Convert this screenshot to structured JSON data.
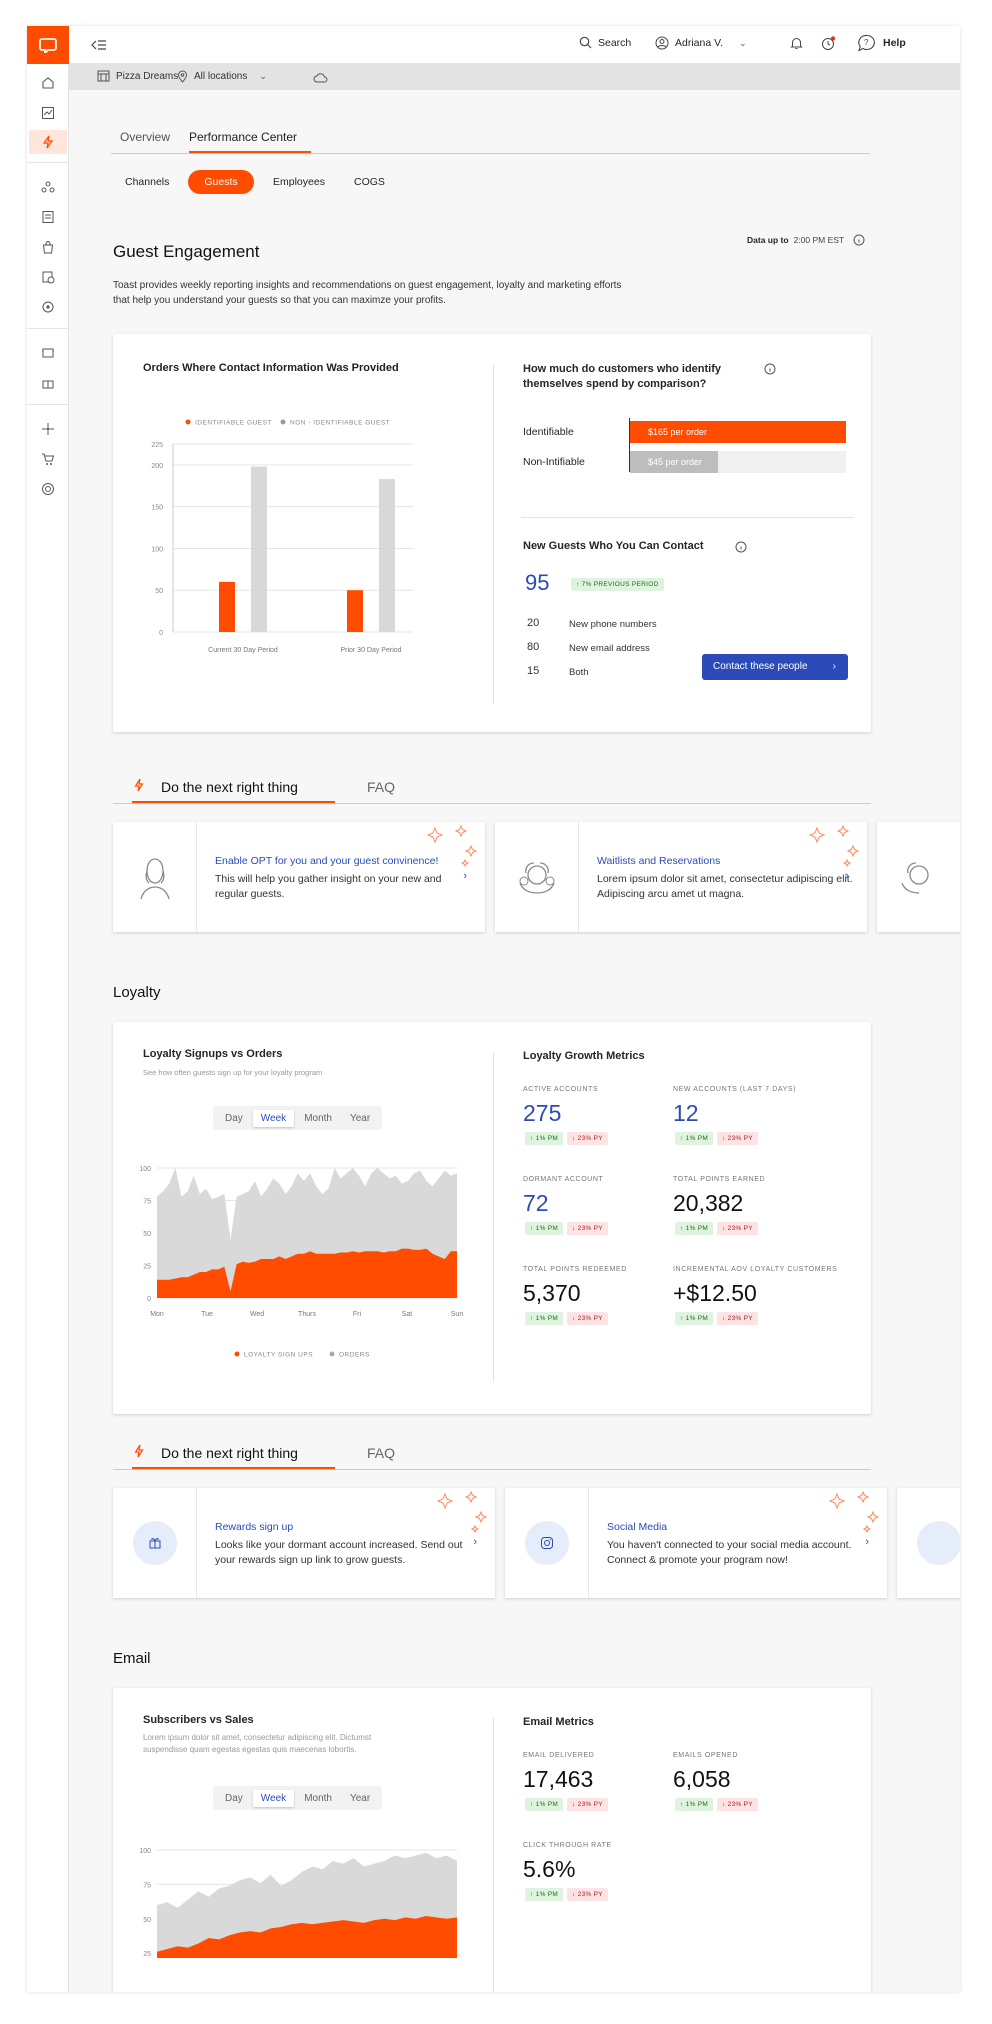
{
  "topbar": {
    "search_label": "Search",
    "user_name": "Adriana V.",
    "help_label": "Help"
  },
  "subbar": {
    "restaurant": "Pizza Dreams",
    "locations": "All locations"
  },
  "tabs": {
    "overview": "Overview",
    "performance": "Performance Center"
  },
  "subtabs": {
    "channels": "Channels",
    "guests": "Guests",
    "employees": "Employees",
    "cogs": "COGS"
  },
  "guest": {
    "title": "Guest Engagement",
    "data_up_to_label": "Data up to",
    "data_up_to_time": "2:00 PM EST",
    "description_1": "Toast provides weekly reporting insights and recommendations on guest engagement, loyalty and marketing efforts",
    "description_2": "that help you understand your guests so that you can maximze your profits.",
    "orders_title": "Orders Where Contact Information Was Provided",
    "spend_title_1": "How much do customers who identify",
    "spend_title_2": "themselves spend by comparison?",
    "spend_rows": [
      {
        "label": "Identifiable",
        "value": "$165 per order"
      },
      {
        "label": "Non-Intifiable",
        "value": "$45 per order"
      }
    ],
    "new_guests_title": "New Guests Who You Can Contact",
    "new_guests_total": "95",
    "new_guests_badge": "↑ 7% PREVIOUS PERIOD",
    "contact_rows": [
      {
        "n": "20",
        "label": "New phone numbers"
      },
      {
        "n": "80",
        "label": "New email address"
      },
      {
        "n": "15",
        "label": "Both"
      }
    ],
    "contact_button": "Contact these people"
  },
  "chart_data": [
    {
      "type": "bar",
      "legend": [
        "IDENTIFIABLE GUEST",
        "NON - IDENTIFIABLE GUEST"
      ],
      "categories": [
        "Current 30 Day Period",
        "Prior 30 Day Period"
      ],
      "series": [
        {
          "name": "IDENTIFIABLE GUEST",
          "values": [
            60,
            50
          ],
          "color": "#ff4c00"
        },
        {
          "name": "NON - IDENTIFIABLE GUEST",
          "values": [
            198,
            183
          ],
          "color": "#d8d8d8"
        }
      ],
      "yticks": [
        225,
        200,
        150,
        100,
        50,
        0
      ],
      "ylim": [
        0,
        225
      ]
    },
    {
      "type": "area",
      "title": "Loyalty Signups vs Orders",
      "subtitle": "See how often guests sign up for your loyalty program",
      "x_labels": [
        "Mon",
        "Tue",
        "Wed",
        "Thurs",
        "Fri",
        "Sat",
        "Sun"
      ],
      "yticks": [
        100,
        75,
        50,
        25,
        0
      ],
      "ylim": [
        0,
        100
      ],
      "legend": [
        "LOYALTY SIGN UPS",
        "ORDERS"
      ],
      "series": [
        {
          "name": "ORDERS",
          "values": [
            78,
            82,
            88,
            100,
            78,
            82,
            94,
            80,
            84,
            76,
            78,
            80,
            45,
            78,
            80,
            82,
            90,
            78,
            84,
            92,
            88,
            80,
            86,
            96,
            90,
            96,
            86,
            80,
            84,
            100,
            92,
            96,
            100,
            94,
            86,
            96,
            100,
            96,
            92,
            94,
            88,
            90,
            96,
            98,
            90,
            86,
            92,
            98,
            94,
            96
          ]
        },
        {
          "name": "LOYALTY SIGN UPS",
          "values": [
            14,
            14,
            14,
            15,
            16,
            16,
            18,
            20,
            20,
            22,
            22,
            24,
            5,
            26,
            28,
            27,
            28,
            30,
            30,
            30,
            32,
            30,
            32,
            34,
            34,
            36,
            34,
            34,
            34,
            34,
            35,
            35,
            36,
            35,
            36,
            36,
            36,
            35,
            36,
            36,
            38,
            38,
            37,
            37,
            38,
            34,
            32,
            30,
            36,
            36
          ]
        }
      ]
    },
    {
      "type": "area",
      "title": "Subscribers vs Sales",
      "x_labels": [],
      "yticks": [
        100,
        75,
        50,
        25
      ],
      "ylim": [
        20,
        100
      ],
      "series": [
        {
          "name": "Sales",
          "values": [
            60,
            62,
            58,
            64,
            70,
            66,
            72,
            74,
            78,
            80,
            76,
            82,
            74,
            78,
            84,
            88,
            86,
            92,
            90,
            94,
            88,
            90,
            92,
            96,
            94,
            96,
            98,
            94,
            96,
            92
          ]
        },
        {
          "name": "Subscribers",
          "values": [
            26,
            28,
            30,
            29,
            32,
            36,
            35,
            38,
            40,
            41,
            40,
            43,
            44,
            46,
            47,
            46,
            47,
            48,
            49,
            48,
            47,
            49,
            50,
            49,
            51,
            50,
            52,
            51,
            50,
            51
          ]
        }
      ]
    }
  ],
  "next_title": "Do the next right thing",
  "faq_label": "FAQ",
  "tiles1": [
    {
      "title": "Enable OPT for you and your guest convinence!",
      "desc": "This will help you gather insight on your new and regular guests."
    },
    {
      "title": "Waitlists and Reservations",
      "desc": "Lorem ipsum dolor sit amet, consectetur adipiscing elit. Adipiscing arcu amet ut magna."
    }
  ],
  "loyalty": {
    "title": "Loyalty",
    "segments": [
      "Day",
      "Week",
      "Month",
      "Year"
    ],
    "metrics_title": "Loyalty Growth Metrics",
    "metrics": [
      {
        "label": "ACTIVE ACCOUNTS",
        "value": "275"
      },
      {
        "label": "NEW ACCOUNTS (LAST 7 DAYS)",
        "value": "12"
      },
      {
        "label": "DORMANT ACCOUNT",
        "value": "72"
      },
      {
        "label": "TOTAL POINTS EARNED",
        "value": "20,382"
      },
      {
        "label": "TOTAL POINTS REDEEMED",
        "value": "5,370"
      },
      {
        "label": "INCREMENTAL AOV LOYALTY CUSTOMERS",
        "value": "+$12.50"
      }
    ],
    "badge_pm": "↑ 1% PM",
    "badge_py": "↓ 23% PY"
  },
  "tiles2": [
    {
      "title": "Rewards sign up",
      "desc": "Looks like your dormant account increased. Send out your rewards sign up link to grow guests."
    },
    {
      "title": "Social Media",
      "desc": "You haven't connected to your social media account. Connect & promote your program now!"
    }
  ],
  "email": {
    "title": "Email",
    "subtitle": "Lorem ipsum dolor sit amet, consectetur adipiscing elit. Dictumst suspendisse quam egestas egestas quis maecenas lobortis.",
    "metrics_title": "Email Metrics",
    "metrics": [
      {
        "label": "EMAIL DELIVERED",
        "value": "17,463"
      },
      {
        "label": "EMAILS OPENED",
        "value": "6,058"
      },
      {
        "label": "CLICK THROUGH RATE",
        "value": "5.6%"
      }
    ]
  },
  "colors": {
    "accent": "#ff4c00",
    "blue": "#2b4bb9"
  }
}
